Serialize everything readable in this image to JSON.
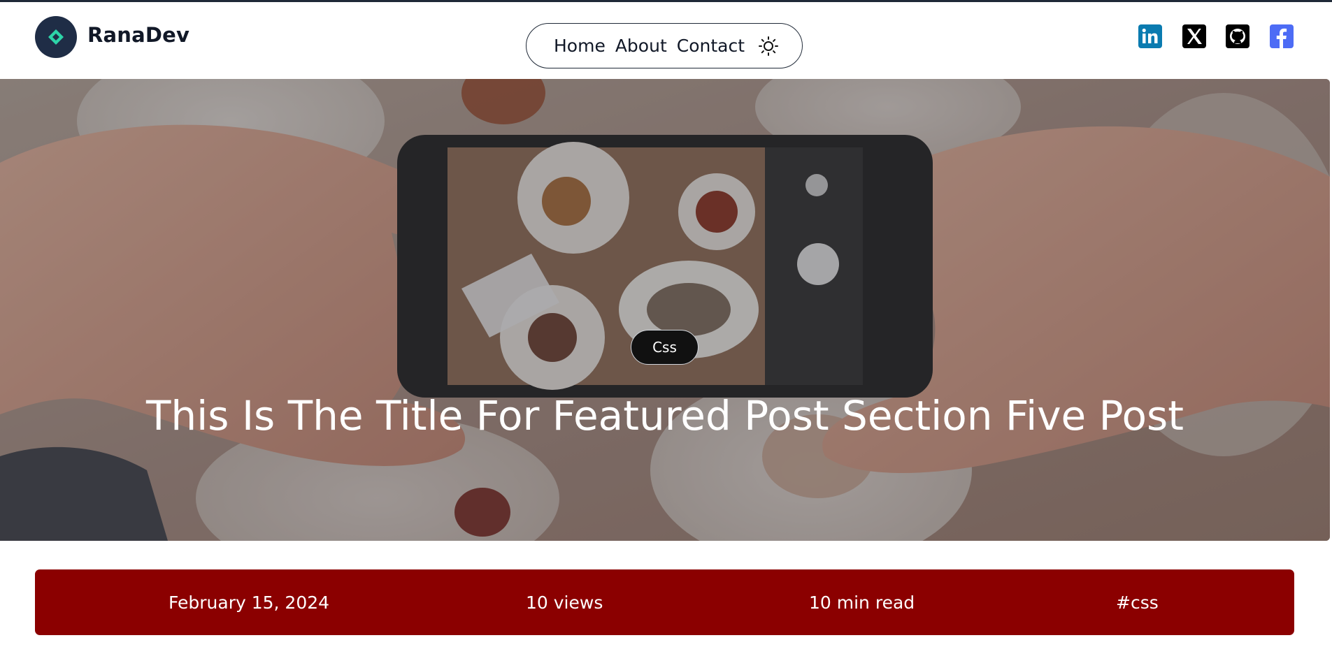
{
  "header": {
    "brand": "RanaDev",
    "nav": [
      {
        "label": "Home"
      },
      {
        "label": "About"
      },
      {
        "label": "Contact"
      }
    ],
    "theme_icon": "sun-icon",
    "socials": [
      {
        "name": "linkedin-icon",
        "color": "#0a66c2"
      },
      {
        "name": "x-icon",
        "color": "#000000"
      },
      {
        "name": "github-icon",
        "color": "#000000"
      },
      {
        "name": "facebook-icon",
        "color": "#4d6cf5"
      }
    ]
  },
  "hero": {
    "category": "Css",
    "title": "This Is The Title For Featured Post Section Five Post"
  },
  "meta": {
    "date": "February 15, 2024",
    "views": "10 views",
    "read_time": "10 min read",
    "hashtag": "#css",
    "accent_color": "#8b0000"
  }
}
